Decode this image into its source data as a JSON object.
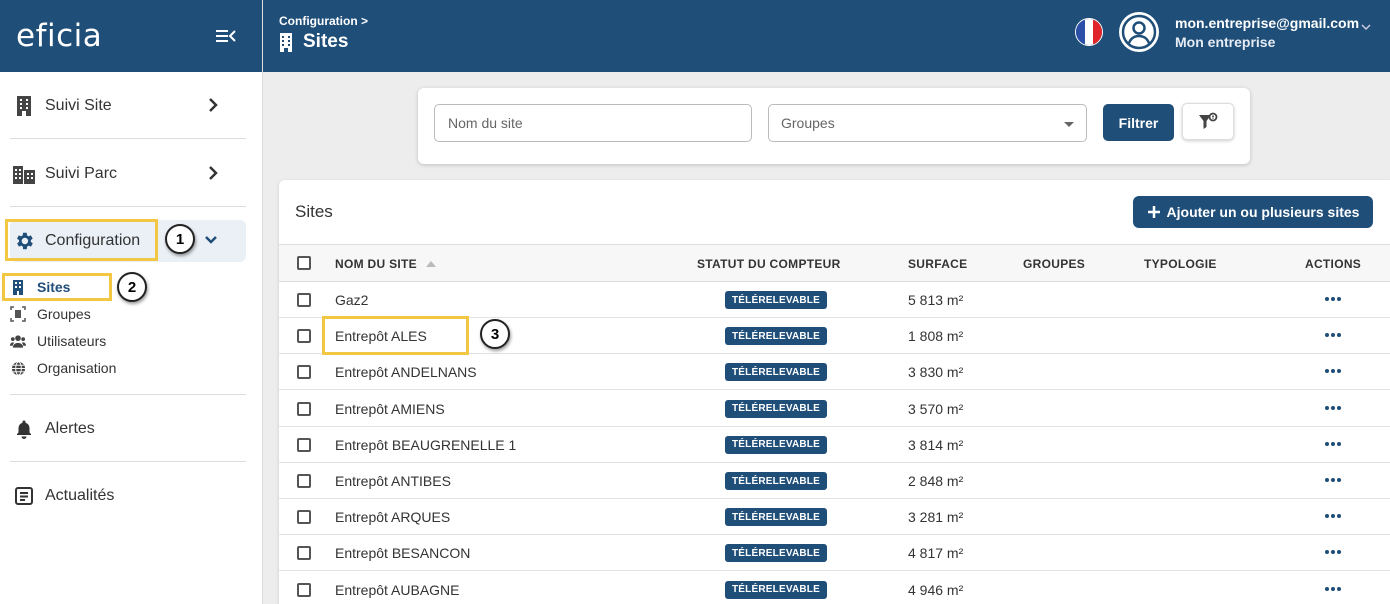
{
  "sidebar": {
    "logo": "eficia",
    "items": [
      {
        "label": "Suivi Site"
      },
      {
        "label": "Suivi Parc"
      },
      {
        "label": "Configuration"
      },
      {
        "label": "Alertes"
      },
      {
        "label": "Actualités"
      }
    ],
    "sub_items": [
      {
        "label": "Sites"
      },
      {
        "label": "Groupes"
      },
      {
        "label": "Utilisateurs"
      },
      {
        "label": "Organisation"
      }
    ]
  },
  "callouts": [
    "1",
    "2",
    "3"
  ],
  "header": {
    "breadcrumb": "Configuration >",
    "title": "Sites",
    "user_email": "mon.entreprise@gmail.com",
    "user_org": "Mon entreprise"
  },
  "filters": {
    "site_placeholder": "Nom du site",
    "groups_placeholder": "Groupes",
    "filter_button": "Filtrer"
  },
  "table": {
    "title": "Sites",
    "add_button": "Ajouter un ou plusieurs sites",
    "columns": [
      "NOM DU SITE",
      "STATUT DU COMPTEUR",
      "SURFACE",
      "GROUPES",
      "TYPOLOGIE",
      "ACTIONS"
    ],
    "rows": [
      {
        "name": "Gaz2",
        "status": "TÉLÉRELEVABLE",
        "surface": "5 813 m²"
      },
      {
        "name": "Entrepôt ALES",
        "status": "TÉLÉRELEVABLE",
        "surface": "1 808 m²"
      },
      {
        "name": "Entrepôt ANDELNANS",
        "status": "TÉLÉRELEVABLE",
        "surface": "3 830 m²"
      },
      {
        "name": "Entrepôt AMIENS",
        "status": "TÉLÉRELEVABLE",
        "surface": "3 570 m²"
      },
      {
        "name": "Entrepôt BEAUGRENELLE 1",
        "status": "TÉLÉRELEVABLE",
        "surface": "3 814 m²"
      },
      {
        "name": "Entrepôt ANTIBES",
        "status": "TÉLÉRELEVABLE",
        "surface": "2 848 m²"
      },
      {
        "name": "Entrepôt ARQUES",
        "status": "TÉLÉRELEVABLE",
        "surface": "3 281 m²"
      },
      {
        "name": "Entrepôt BESANCON",
        "status": "TÉLÉRELEVABLE",
        "surface": "4 817 m²"
      },
      {
        "name": "Entrepôt AUBAGNE",
        "status": "TÉLÉRELEVABLE",
        "surface": "4 946 m²"
      }
    ]
  },
  "colors": {
    "primary": "#1f4e79",
    "highlight": "#f2c744",
    "active_bg": "#ebf0f7"
  },
  "icons": [
    "menu-collapse-icon",
    "building-icon",
    "buildings-icon",
    "gear-icon",
    "bell-icon",
    "news-icon",
    "group-icon",
    "users-icon",
    "globe-icon",
    "chevron-right-icon",
    "chevron-down-icon",
    "flag-fr-icon",
    "user-avatar-icon",
    "filter-reset-icon",
    "plus-icon",
    "sort-asc-icon",
    "more-actions-icon"
  ]
}
